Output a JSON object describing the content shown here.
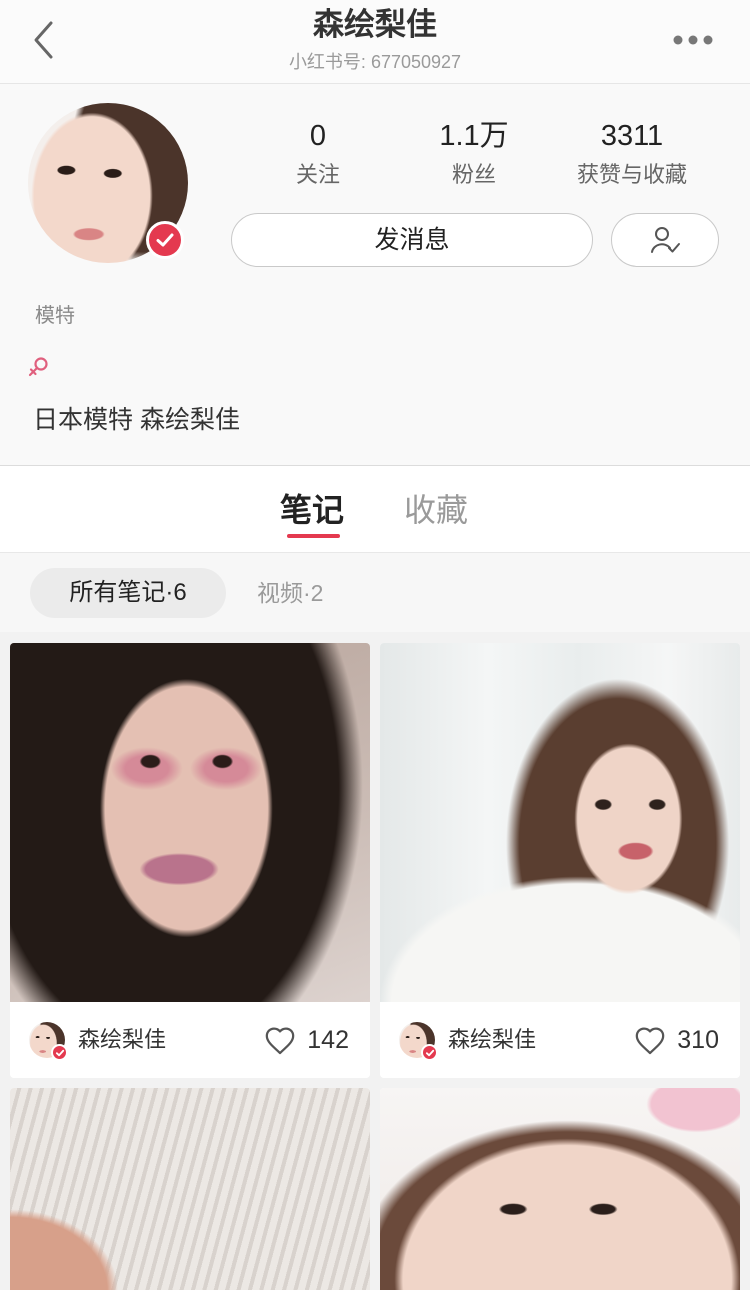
{
  "nav": {
    "title": "森绘梨佳",
    "subtitle": "小红书号: 677050927",
    "back_icon": "chevron-left-icon",
    "more_icon": "more-dots-icon"
  },
  "profile": {
    "stats": [
      {
        "value": "0",
        "label": "关注"
      },
      {
        "value": "1.1万",
        "label": "粉丝"
      },
      {
        "value": "3311",
        "label": "获赞与收藏"
      }
    ],
    "message_button": "发消息",
    "follow_button_icon": "user-check-icon",
    "verified_badge_icon": "verified-check-icon",
    "tag": "模特",
    "gender_icon": "female-icon",
    "bio": "日本模特 森绘梨佳"
  },
  "tabs": [
    {
      "label": "笔记",
      "active": true
    },
    {
      "label": "收藏",
      "active": false
    }
  ],
  "filters": [
    {
      "label": "所有笔记·6",
      "active": true
    },
    {
      "label": "视频·2",
      "active": false
    }
  ],
  "notes": [
    {
      "author": "森绘梨佳",
      "likes": "142",
      "like_icon": "heart-icon"
    },
    {
      "author": "森绘梨佳",
      "likes": "310",
      "like_icon": "heart-icon"
    }
  ],
  "colors": {
    "accent": "#e4394f",
    "gender_icon": "#e0607e"
  }
}
